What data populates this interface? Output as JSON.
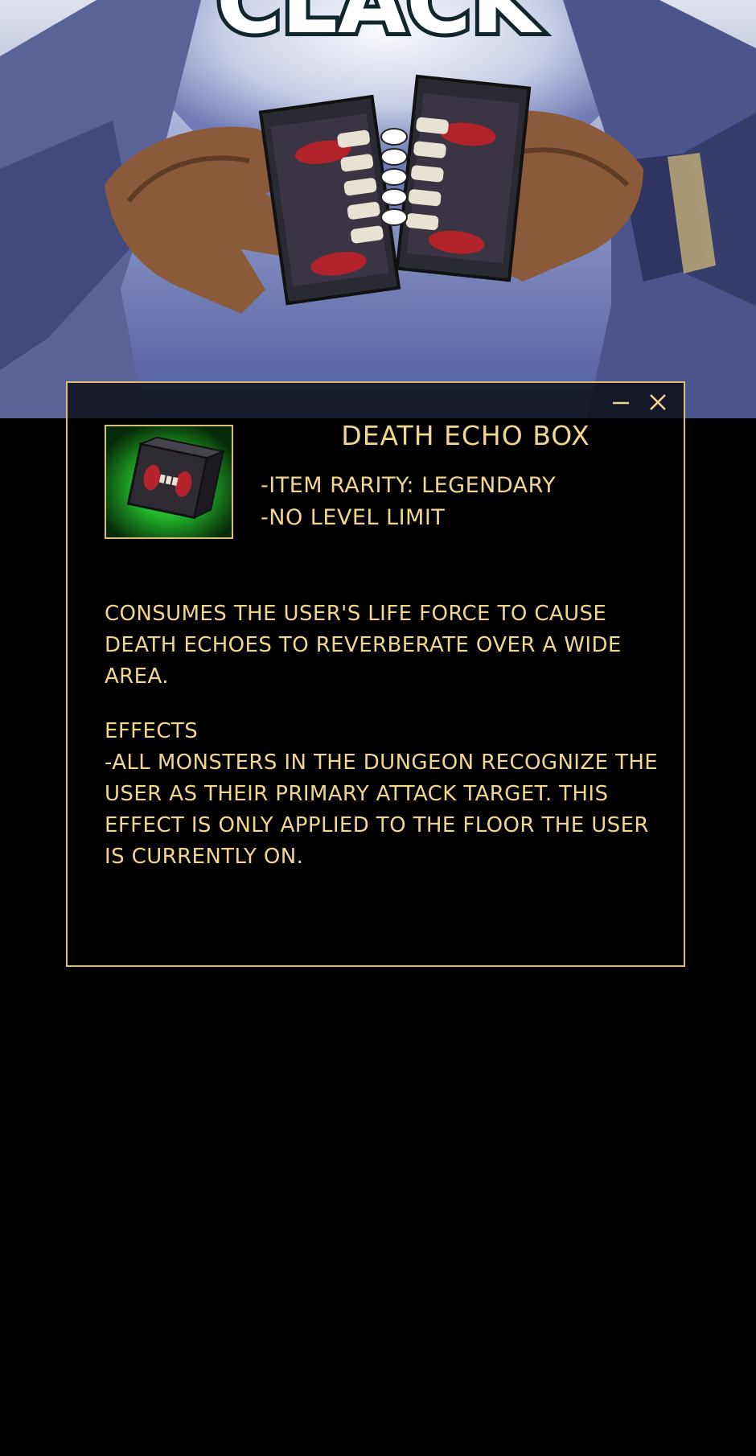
{
  "panel": {
    "sound_effect": "CLACK"
  },
  "window": {
    "minimize_label": "minimize",
    "close_label": "close"
  },
  "item": {
    "name": "DEATH ECHO BOX",
    "rarity": "-ITEM RARITY: LEGENDARY",
    "level_limit": "-NO LEVEL LIMIT",
    "description": "CONSUMES THE USER'S LIFE FORCE TO CAUSE DEATH ECHOES TO REVERBERATE OVER A WIDE AREA.",
    "effects_heading": "EFFECTS",
    "effects_text": "-ALL MONSTERS IN THE DUNGEON RECOGNIZE THE USER AS THEIR PRIMARY ATTACK TARGET. THIS EFFECT IS ONLY APPLIED TO THE FLOOR THE USER IS CURRENTLY ON.",
    "icon": "death-echo-box-icon"
  },
  "colors": {
    "accent": "#d9bd76",
    "text": "#f2d68e",
    "background": "#000000",
    "icon_glow": "#3ddc3a"
  }
}
